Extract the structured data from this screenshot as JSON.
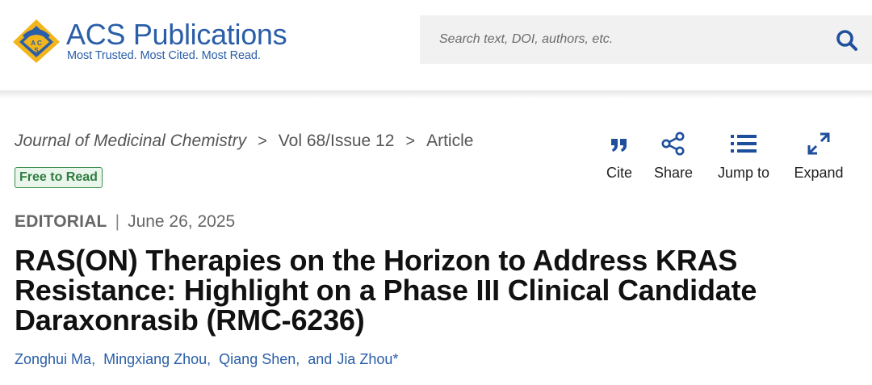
{
  "header": {
    "logo": {
      "title_prefix": "ACS",
      "title_suffix": "Publications",
      "tagline": "Most Trusted. Most Cited. Most Read.",
      "mark_text": "ACS",
      "brand_color": "#2a5ea8",
      "mark_color": "#f2b51c"
    },
    "search": {
      "placeholder": "Search text, DOI, authors, etc.",
      "value": "",
      "icon": "search-icon"
    }
  },
  "breadcrumb": {
    "journal": "Journal of Medicinal Chemistry",
    "issue": "Vol 68/Issue 12",
    "page": "Article",
    "separator": ">"
  },
  "access_badge": {
    "label": "Free to Read",
    "color": "#2f7d3f"
  },
  "tools": [
    {
      "label": "Cite",
      "icon": "quote-icon"
    },
    {
      "label": "Share",
      "icon": "share-icon"
    },
    {
      "label": "Jump to",
      "icon": "list-icon"
    },
    {
      "label": "Expand",
      "icon": "expand-icon"
    }
  ],
  "article": {
    "type": "EDITORIAL",
    "date": "June 26, 2025",
    "title_lines": [
      "RAS(ON) Therapies on the Horizon to Address KRAS",
      "Resistance: Highlight on a Phase III Clinical Candidate",
      "Daraxonrasib (RMC-6236)"
    ],
    "authors": [
      "Zonghui Ma",
      "Mingxiang Zhou",
      "Qiang Shen",
      "Jia Zhou*"
    ],
    "author_separator": ",",
    "author_conjunction": "and"
  }
}
